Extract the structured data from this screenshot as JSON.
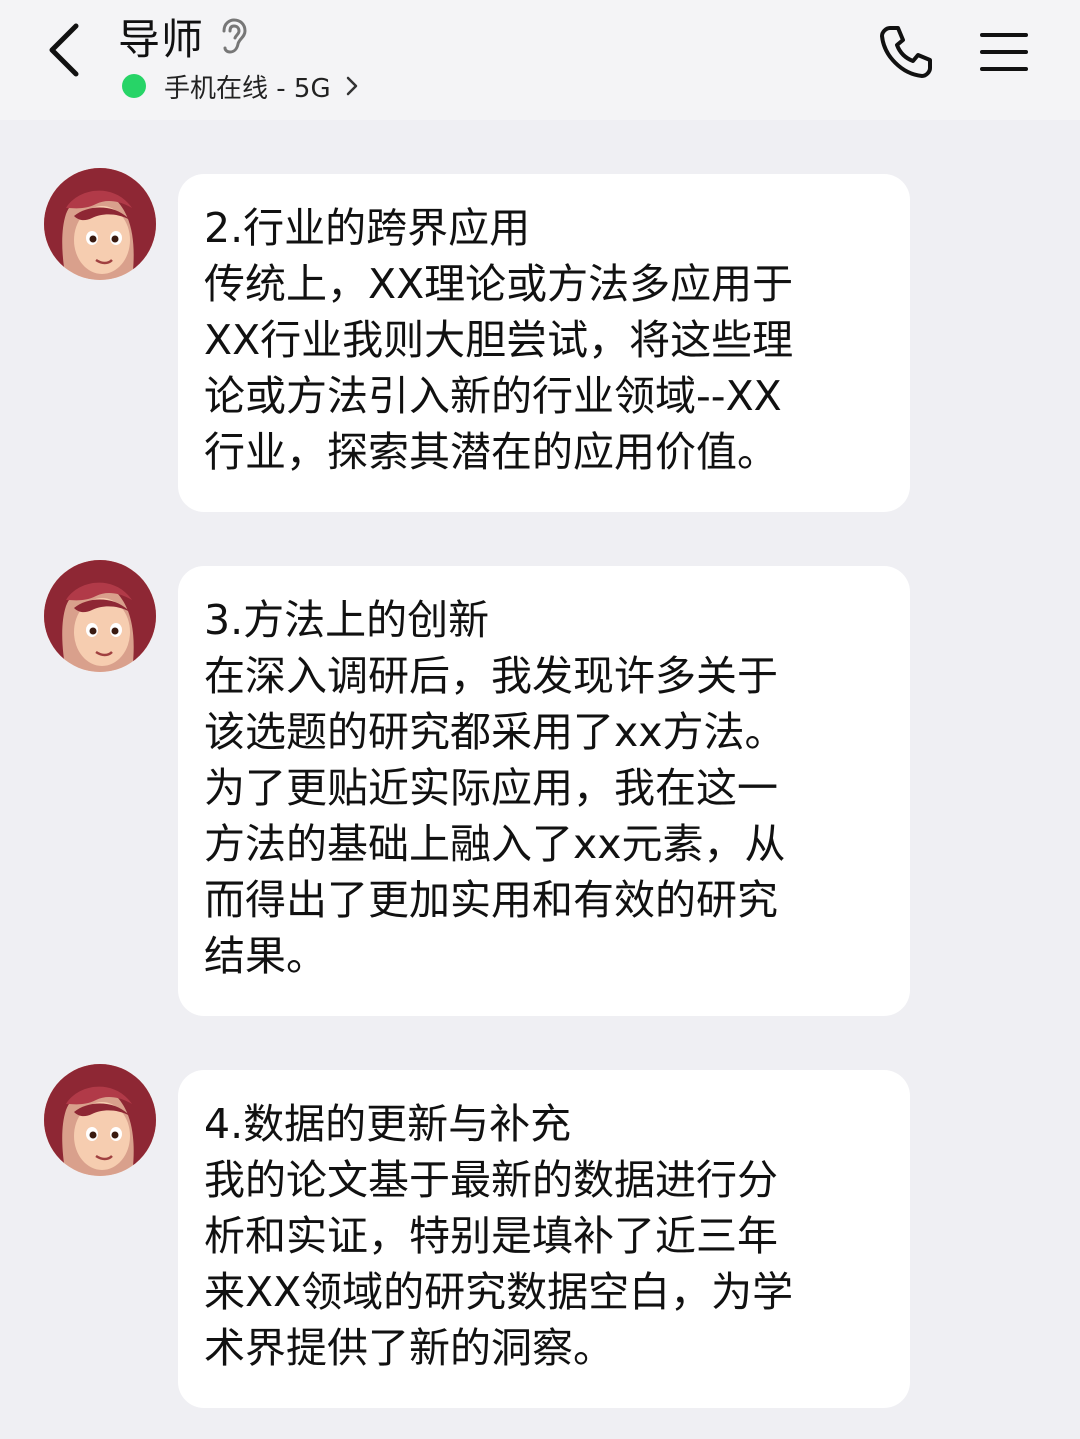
{
  "header": {
    "back_icon": "chevron-left-icon",
    "title": "导师",
    "title_icon": "ear-icon",
    "status_text": "手机在线 - 5G",
    "status_color": "#27d467",
    "status_chevron_icon": "chevron-right-icon",
    "phone_icon": "phone-icon",
    "menu_icon": "menu-icon"
  },
  "messages": [
    {
      "avatar": "avatar",
      "lines": [
        "2.行业的跨界应用",
        "传统上，XX理论或方法多应用于",
        "XX行业我则大胆尝试，将这些理",
        "论或方法引入新的行业领域--XX",
        "行业，探索其潜在的应用价值。"
      ]
    },
    {
      "avatar": "avatar",
      "lines": [
        "3.方法上的创新",
        "在深入调研后，我发现许多关于",
        "该选题的研究都采用了xx方法。",
        "为了更贴近实际应用，我在这一",
        "方法的基础上融入了xx元素，从",
        "而得出了更加实用和有效的研究",
        "结果。"
      ]
    },
    {
      "avatar": "avatar",
      "lines": [
        "4.数据的更新与补充",
        "我的论文基于最新的数据进行分",
        "析和实证，特别是填补了近三年",
        "来XX领域的研究数据空白，为学",
        "术界提供了新的洞察。"
      ]
    }
  ],
  "colors": {
    "background": "#efeff3",
    "header_bg": "#f4f4f6",
    "bubble_bg": "#ffffff",
    "online_dot": "#27d467"
  }
}
